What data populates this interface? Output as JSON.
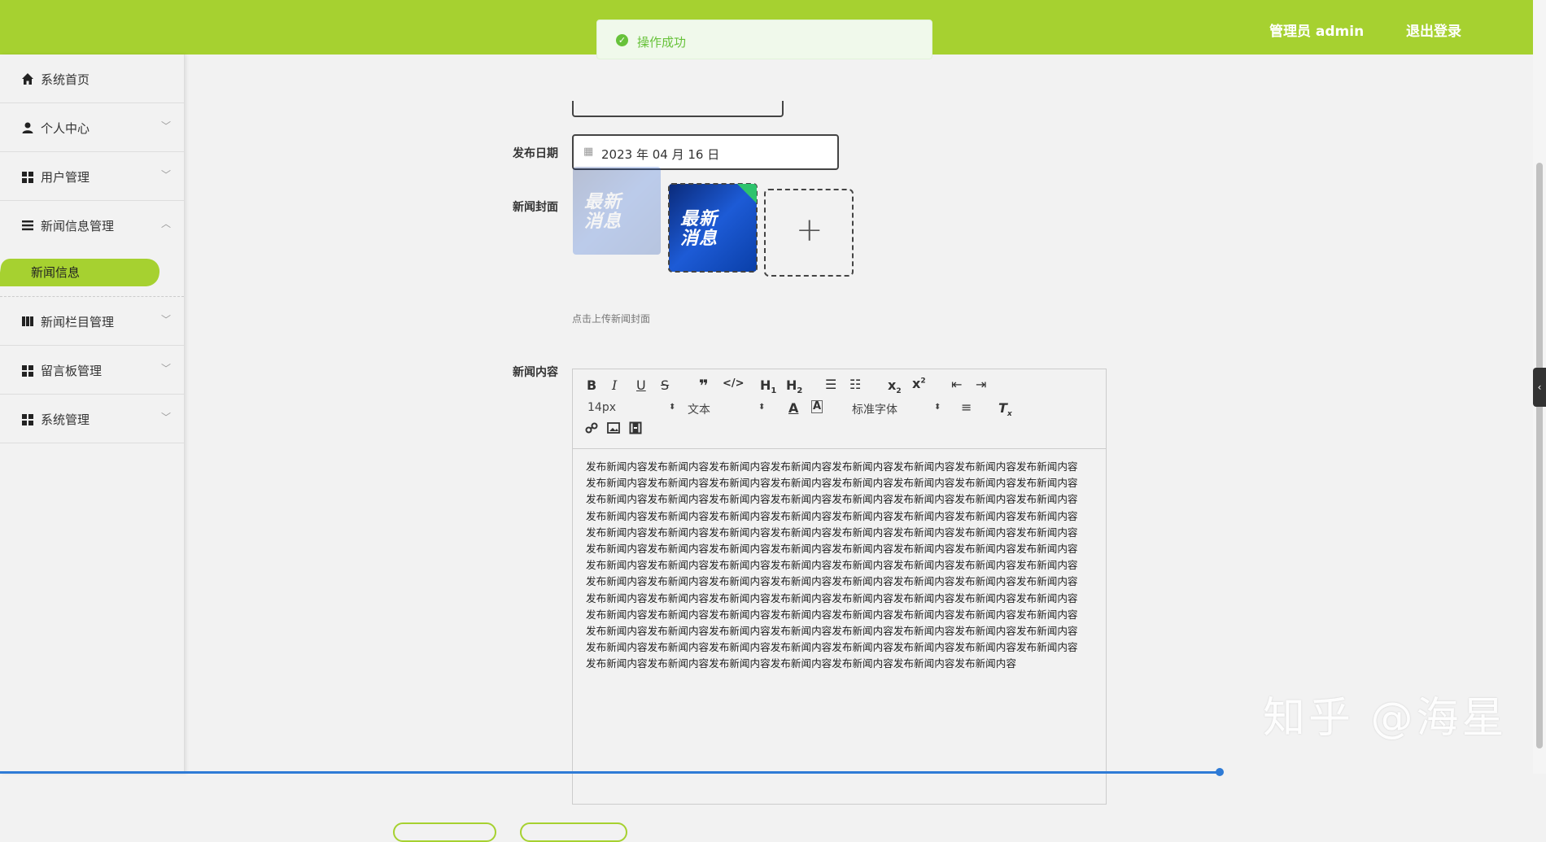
{
  "header": {
    "admin_label": "管理员 admin",
    "logout_label": "退出登录"
  },
  "toast": {
    "message": "操作成功"
  },
  "sidebar": {
    "items": [
      {
        "label": "系统首页",
        "icon": "home-icon"
      },
      {
        "label": "个人中心",
        "icon": "user-icon"
      },
      {
        "label": "用户管理",
        "icon": "grid-icon"
      },
      {
        "label": "新闻信息管理",
        "icon": "list-icon"
      },
      {
        "label": "新闻栏目管理",
        "icon": "book-icon"
      },
      {
        "label": "留言板管理",
        "icon": "grid-icon"
      },
      {
        "label": "系统管理",
        "icon": "grid-icon"
      }
    ],
    "active_sub": "新闻信息"
  },
  "form": {
    "date_label": "发布日期",
    "date_value": "2023 年 04 月 16 日",
    "cover_label": "新闻封面",
    "cover_image_text_line1": "最新",
    "cover_image_text_line2": "消息",
    "upload_hint": "点击上传新闻封面",
    "content_label": "新闻内容"
  },
  "editor": {
    "size_value": "14px",
    "header_value": "文本",
    "font_value": "标准字体",
    "content": "发布新闻内容发布新闻内容发布新闻内容发布新闻内容发布新闻内容发布新闻内容发布新闻内容发布新闻内容发布新闻内容发布新闻内容发布新闻内容发布新闻内容发布新闻内容发布新闻内容发布新闻内容发布新闻内容发布新闻内容发布新闻内容发布新闻内容发布新闻内容发布新闻内容发布新闻内容发布新闻内容发布新闻内容发布新闻内容发布新闻内容发布新闻内容发布新闻内容发布新闻内容发布新闻内容发布新闻内容发布新闻内容发布新闻内容发布新闻内容发布新闻内容发布新闻内容发布新闻内容发布新闻内容发布新闻内容发布新闻内容发布新闻内容发布新闻内容发布新闻内容发布新闻内容发布新闻内容发布新闻内容发布新闻内容发布新闻内容发布新闻内容发布新闻内容发布新闻内容发布新闻内容发布新闻内容发布新闻内容发布新闻内容发布新闻内容发布新闻内容发布新闻内容发布新闻内容发布新闻内容发布新闻内容发布新闻内容发布新闻内容发布新闻内容发布新闻内容发布新闻内容发布新闻内容发布新闻内容发布新闻内容发布新闻内容发布新闻内容发布新闻内容发布新闻内容发布新闻内容发布新闻内容发布新闻内容发布新闻内容发布新闻内容发布新闻内容发布新闻内容发布新闻内容发布新闻内容发布新闻内容发布新闻内容发布新闻内容发布新闻内容发布新闻内容发布新闻内容发布新闻内容发布新闻内容发布新闻内容发布新闻内容发布新闻内容发布新闻内容发布新闻内容发布新闻内容发布新闻内容发布新闻内容发布新闻内容发布新闻内容发布新闻内容发布新闻内容发布新闻内容"
  },
  "watermark": "知乎 @海星",
  "colors": {
    "brand": "#a6d130",
    "success": "#67c23a",
    "accent_blue": "#2f7bd6"
  }
}
